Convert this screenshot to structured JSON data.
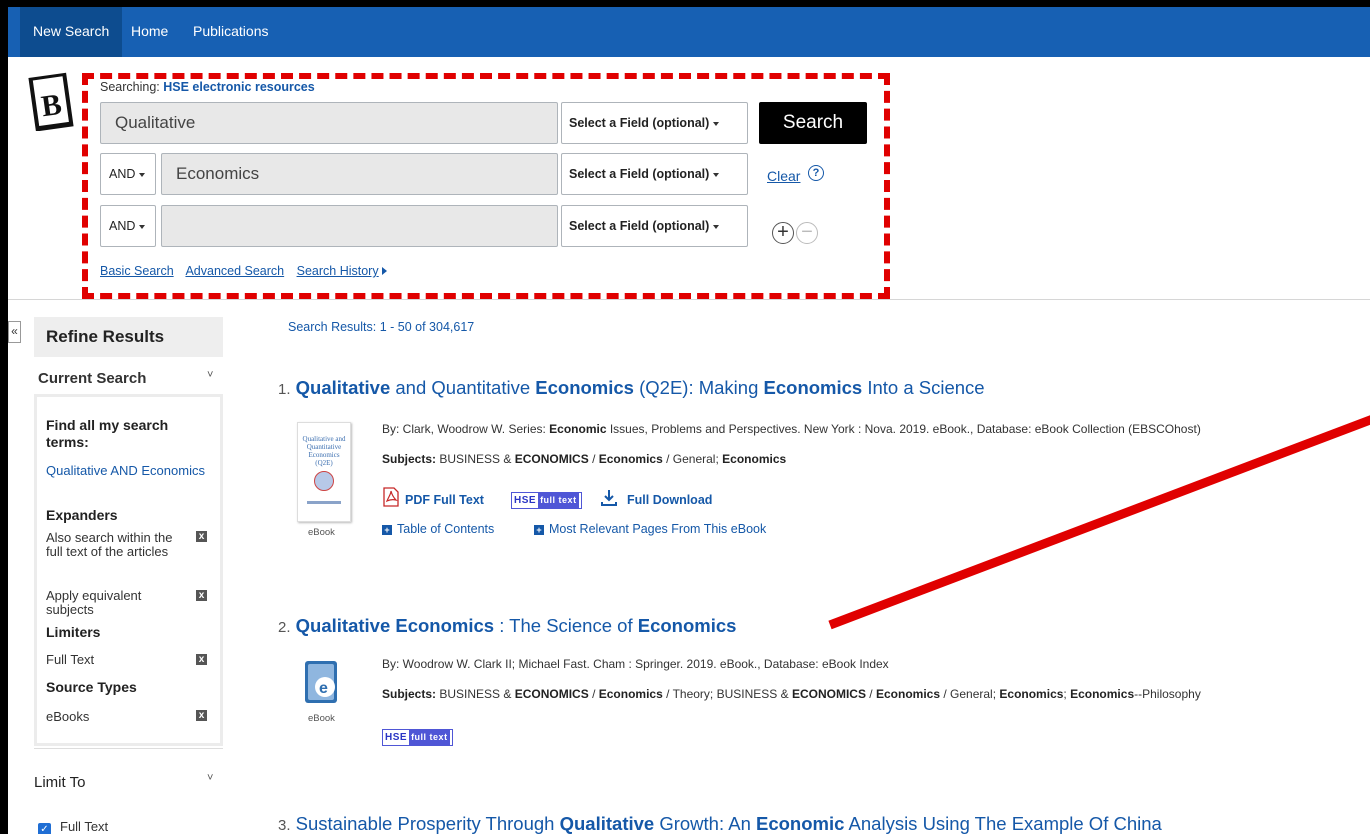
{
  "nav": {
    "items": [
      "New Search",
      "Home",
      "Publications"
    ]
  },
  "search": {
    "searching_label": "Searching:",
    "database": "HSE electronic resources",
    "rows": [
      {
        "value": "Qualitative",
        "field": "Select a Field (optional)"
      },
      {
        "bool": "AND",
        "value": "Economics",
        "field": "Select a Field (optional)"
      },
      {
        "bool": "AND",
        "value": "",
        "field": "Select a Field (optional)"
      }
    ],
    "search_button": "Search",
    "clear": "Clear",
    "help": "?",
    "basic_search": "Basic Search",
    "advanced_search": "Advanced Search",
    "search_history": "Search History"
  },
  "sidebar": {
    "collapse": "«",
    "refine_title": "Refine Results",
    "current_search": "Current Search",
    "find_all": "Find all my search terms:",
    "query": "Qualitative AND Economics",
    "expanders": "Expanders",
    "expander_items": [
      "Also search within the full text of the articles",
      "Apply equivalent subjects"
    ],
    "limiters": "Limiters",
    "limiter_items": [
      "Full Text"
    ],
    "source_types": "Source Types",
    "source_items": [
      "eBooks"
    ],
    "limit_to": "Limit To",
    "limit_full_text": "Full Text"
  },
  "results": {
    "summary": "Search Results: 1 - 50 of 304,617",
    "items": [
      {
        "num": "1.",
        "title_parts": [
          "Qualitative",
          " and Quantitative ",
          "Economics",
          " (Q2E): Making ",
          "Economics",
          " Into a Science"
        ],
        "byline": "By: Clark, Woodrow W. Series: ",
        "byline_bold": "Economic",
        "byline_rest": " Issues, Problems and Perspectives. New York : Nova. 2019. eBook., Database: eBook Collection (EBSCOhost)",
        "subjects_label": "Subjects:",
        "subjects": " BUSINESS & ",
        "subjects_b1": "ECONOMICS",
        "subjects_m1": " / ",
        "subjects_b2": "Economics",
        "subjects_m2": " / General; ",
        "subjects_b3": "Economics",
        "pdf": "PDF Full Text",
        "download": "Full Download",
        "toc": "Table of Contents",
        "relevant": "Most Relevant Pages From This eBook",
        "type": "eBook",
        "cover_title": "Qualitative and Quantitative Economics (Q2E)"
      },
      {
        "num": "2.",
        "title_parts": [
          "Qualitative Economics",
          " : The Science of ",
          "Economics"
        ],
        "byline": "By: Woodrow W. Clark II; Michael Fast. Cham : Springer. 2019. eBook., Database: eBook Index",
        "subjects_label": "Subjects:",
        "type": "eBook"
      },
      {
        "num": "3.",
        "title_parts": [
          "Sustainable Prosperity Through ",
          "Qualitative",
          " Growth: An ",
          "Economic",
          " Analysis Using The Example Of China"
        ]
      }
    ],
    "hse_label": "HSE",
    "ft_label": "full text"
  },
  "colors": {
    "nav_bg": "#1760b3",
    "link": "#1558a8",
    "annotation_red": "#e00000"
  }
}
